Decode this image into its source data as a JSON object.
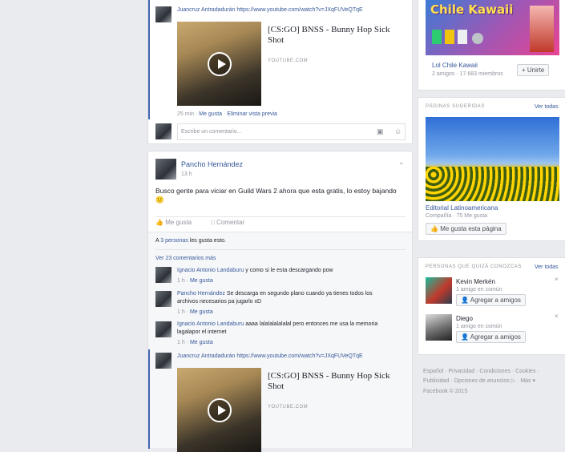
{
  "feed": {
    "shared_top": {
      "text": "Juancruz Antradadurán https://www.youtube.com/watch?v=JXqFUVeQTqE",
      "video_title": "[CS:GO] BNSS - Bunny Hop Sick Shot",
      "video_domain": "YOUTUBE.COM",
      "meta_time": "25 min",
      "meta_like": "Me gusta",
      "meta_delete": "Eliminar vista previa"
    },
    "comment_box": {
      "placeholder": "Escribe un comentario..."
    },
    "post": {
      "author": "Pancho Hernández",
      "time": "13 h",
      "body": "Busco gente para viciar en Guild Wars 2 ahora que esta gratis, lo estoy bajando",
      "emoji": "🙂",
      "like_label": "Me gusta",
      "comment_label": "Comentar",
      "likes_prefix": "A",
      "likes_count": "3 personas",
      "likes_suffix": "les gusta esto.",
      "view_more": "Ver 23 comentarios más"
    },
    "comments": [
      {
        "author": "Ignacio Antonio Landaburu",
        "text": "y como si le esta descargando pow",
        "meta_time": "1 h",
        "meta_like": "Me gusta"
      },
      {
        "author": "Pancho Hernández",
        "text": "Se descarga en segundo plano cuando ya tienes todos los archivos necesarios pa jugarlo xD",
        "meta_time": "1 h",
        "meta_like": "Me gusta"
      },
      {
        "author": "Ignacio Antonio Landaburu",
        "text": "aaaa lalalalalalalal pero entonces me usa la memoria lagalapor el internet",
        "meta_time": "1 h",
        "meta_like": "Me gusta"
      }
    ],
    "shared_bottom": {
      "text": "Juancruz Antradadurán https://www.youtube.com/watch?v=JXqFUVeQTqE",
      "video_title": "[CS:GO] BNSS - Bunny Hop Sick Shot",
      "video_domain": "YOUTUBE.COM"
    }
  },
  "sidebar": {
    "group": {
      "banner_text": "Chile Kawaii",
      "name": "Lol Chile Kawaii",
      "stats": "2 amigos · 17.683 miembros",
      "join_label": "+ Unirte"
    },
    "suggested_pages": {
      "heading": "PÁGINAS SUGERIDAS",
      "see_all": "Ver todas",
      "page_name": "Editorial Latinoamericana",
      "page_meta": "Compañía · 75 Me gusta",
      "like_button": "Me gusta esta página"
    },
    "people": {
      "heading": "PERSONAS QUE QUIZÁ CONOZCAS",
      "see_all": "Ver todas",
      "items": [
        {
          "name": "Kevin Merkén",
          "mutual": "1 amigo en común",
          "button": "Agregar a amigos"
        },
        {
          "name": "Diego",
          "mutual": "1 amigo en común",
          "button": "Agregar a amigos"
        }
      ]
    },
    "footer": {
      "line1": "Español · Privacidad · Condiciones · Cookies ·",
      "line2": "Publicidad · Opciones de anuncios ▷ · Más ▾",
      "line3": "Facebook © 2015"
    }
  },
  "colors": {
    "link": "#365899",
    "accent": "#4267b2",
    "background": "#e9ebee"
  }
}
